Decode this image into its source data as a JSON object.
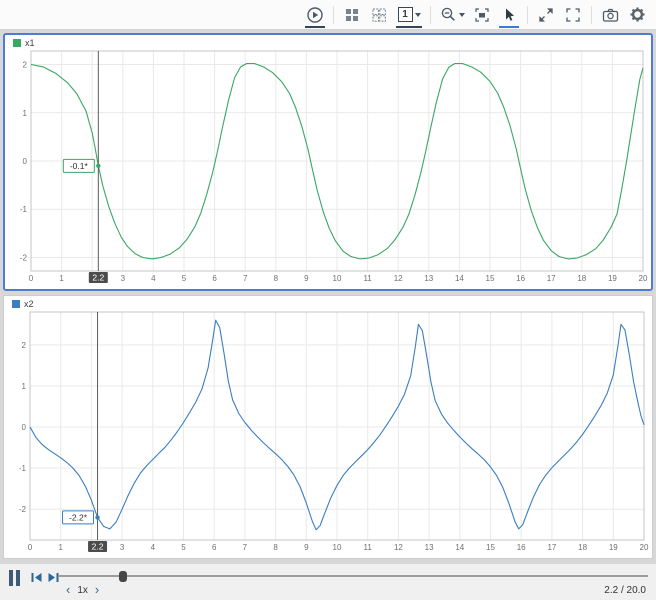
{
  "toolbar": {
    "display_count": "1",
    "icons": [
      "run-icon",
      "layout-grid-icon",
      "edit-layout-icon",
      "display-count-icon",
      "dropdown-caret-icon",
      "zoom-out-icon",
      "fit-to-view-icon",
      "pointer-icon",
      "expand-icon",
      "fullscreen-icon",
      "camera-icon",
      "gear-icon"
    ]
  },
  "chart_data": [
    {
      "id": "x1",
      "type": "line",
      "title": "x1",
      "color": "#3aa763",
      "xlim": [
        0,
        20
      ],
      "ylim": [
        -2.28,
        2.28
      ],
      "xticks": [
        0,
        1,
        2,
        3,
        4,
        5,
        6,
        7,
        8,
        9,
        10,
        11,
        12,
        13,
        14,
        15,
        16,
        17,
        18,
        19,
        20
      ],
      "yticks": [
        -2,
        -1,
        0,
        1,
        2
      ],
      "grid": true,
      "cursor": {
        "x": 2.2,
        "y": -0.1,
        "value_label": "-0.1*",
        "axis_label": "2.2"
      },
      "points": [
        [
          0,
          2.0
        ],
        [
          0.4,
          1.95
        ],
        [
          0.8,
          1.82
        ],
        [
          1.2,
          1.62
        ],
        [
          1.5,
          1.39
        ],
        [
          1.8,
          1.03
        ],
        [
          2.0,
          0.58
        ],
        [
          2.1,
          0.25
        ],
        [
          2.2,
          -0.1
        ],
        [
          2.35,
          -0.52
        ],
        [
          2.55,
          -0.96
        ],
        [
          2.75,
          -1.31
        ],
        [
          2.95,
          -1.58
        ],
        [
          3.15,
          -1.77
        ],
        [
          3.4,
          -1.92
        ],
        [
          3.65,
          -2.0
        ],
        [
          3.95,
          -2.03
        ],
        [
          4.25,
          -2.0
        ],
        [
          4.55,
          -1.93
        ],
        [
          4.85,
          -1.8
        ],
        [
          5.1,
          -1.62
        ],
        [
          5.35,
          -1.37
        ],
        [
          5.55,
          -1.08
        ],
        [
          5.75,
          -0.68
        ],
        [
          5.95,
          -0.2
        ],
        [
          6.1,
          0.22
        ],
        [
          6.25,
          0.68
        ],
        [
          6.45,
          1.25
        ],
        [
          6.65,
          1.72
        ],
        [
          6.85,
          1.95
        ],
        [
          7.05,
          2.02
        ],
        [
          7.3,
          2.02
        ],
        [
          7.6,
          1.95
        ],
        [
          7.9,
          1.83
        ],
        [
          8.2,
          1.64
        ],
        [
          8.45,
          1.4
        ],
        [
          8.65,
          1.1
        ],
        [
          8.85,
          0.72
        ],
        [
          9.05,
          0.25
        ],
        [
          9.2,
          -0.18
        ],
        [
          9.35,
          -0.6
        ],
        [
          9.55,
          -1.05
        ],
        [
          9.75,
          -1.4
        ],
        [
          9.95,
          -1.66
        ],
        [
          10.2,
          -1.87
        ],
        [
          10.45,
          -1.98
        ],
        [
          10.75,
          -2.03
        ],
        [
          11.05,
          -2.01
        ],
        [
          11.35,
          -1.94
        ],
        [
          11.65,
          -1.81
        ],
        [
          11.9,
          -1.63
        ],
        [
          12.15,
          -1.38
        ],
        [
          12.35,
          -1.1
        ],
        [
          12.55,
          -0.7
        ],
        [
          12.75,
          -0.22
        ],
        [
          12.9,
          0.2
        ],
        [
          13.05,
          0.65
        ],
        [
          13.25,
          1.22
        ],
        [
          13.45,
          1.7
        ],
        [
          13.65,
          1.94
        ],
        [
          13.85,
          2.02
        ],
        [
          14.1,
          2.02
        ],
        [
          14.4,
          1.95
        ],
        [
          14.7,
          1.84
        ],
        [
          15.0,
          1.65
        ],
        [
          15.25,
          1.41
        ],
        [
          15.45,
          1.11
        ],
        [
          15.65,
          0.74
        ],
        [
          15.85,
          0.27
        ],
        [
          16.0,
          -0.16
        ],
        [
          16.15,
          -0.58
        ],
        [
          16.35,
          -1.03
        ],
        [
          16.55,
          -1.38
        ],
        [
          16.75,
          -1.65
        ],
        [
          17.0,
          -1.86
        ],
        [
          17.25,
          -1.98
        ],
        [
          17.55,
          -2.03
        ],
        [
          17.85,
          -2.01
        ],
        [
          18.15,
          -1.94
        ],
        [
          18.45,
          -1.82
        ],
        [
          18.7,
          -1.64
        ],
        [
          18.95,
          -1.38
        ],
        [
          19.15,
          -1.1
        ],
        [
          19.3,
          -0.6
        ],
        [
          19.45,
          -0.05
        ],
        [
          19.6,
          0.55
        ],
        [
          19.75,
          1.15
        ],
        [
          19.9,
          1.7
        ],
        [
          20,
          1.93
        ]
      ]
    },
    {
      "id": "x2",
      "type": "line",
      "title": "x2",
      "color": "#3a7ebf",
      "xlim": [
        0,
        20
      ],
      "ylim": [
        -2.75,
        2.8
      ],
      "xticks": [
        0,
        1,
        2,
        3,
        4,
        5,
        6,
        7,
        8,
        9,
        10,
        11,
        12,
        13,
        14,
        15,
        16,
        17,
        18,
        19,
        20
      ],
      "yticks": [
        -2,
        -1,
        0,
        1,
        2
      ],
      "grid": true,
      "cursor": {
        "x": 2.2,
        "y": -2.2,
        "value_label": "-2.2*",
        "axis_label": "2.2"
      },
      "points": [
        [
          0,
          0
        ],
        [
          0.2,
          -0.26
        ],
        [
          0.4,
          -0.43
        ],
        [
          0.6,
          -0.55
        ],
        [
          0.8,
          -0.65
        ],
        [
          1.0,
          -0.75
        ],
        [
          1.2,
          -0.86
        ],
        [
          1.4,
          -1.0
        ],
        [
          1.6,
          -1.18
        ],
        [
          1.8,
          -1.44
        ],
        [
          2.0,
          -1.78
        ],
        [
          2.2,
          -2.2
        ],
        [
          2.4,
          -2.42
        ],
        [
          2.6,
          -2.48
        ],
        [
          2.8,
          -2.32
        ],
        [
          3.0,
          -2.0
        ],
        [
          3.2,
          -1.66
        ],
        [
          3.4,
          -1.36
        ],
        [
          3.6,
          -1.12
        ],
        [
          3.8,
          -0.94
        ],
        [
          4.0,
          -0.79
        ],
        [
          4.2,
          -0.64
        ],
        [
          4.4,
          -0.49
        ],
        [
          4.6,
          -0.31
        ],
        [
          4.8,
          -0.11
        ],
        [
          5.0,
          0.11
        ],
        [
          5.2,
          0.35
        ],
        [
          5.4,
          0.61
        ],
        [
          5.6,
          0.92
        ],
        [
          5.8,
          1.44
        ],
        [
          5.95,
          2.12
        ],
        [
          6.05,
          2.6
        ],
        [
          6.18,
          2.42
        ],
        [
          6.32,
          1.8
        ],
        [
          6.46,
          1.12
        ],
        [
          6.6,
          0.66
        ],
        [
          6.8,
          0.33
        ],
        [
          7.0,
          0.11
        ],
        [
          7.2,
          -0.07
        ],
        [
          7.4,
          -0.23
        ],
        [
          7.6,
          -0.38
        ],
        [
          7.8,
          -0.52
        ],
        [
          8.0,
          -0.65
        ],
        [
          8.2,
          -0.79
        ],
        [
          8.4,
          -0.96
        ],
        [
          8.6,
          -1.17
        ],
        [
          8.8,
          -1.46
        ],
        [
          9.0,
          -1.85
        ],
        [
          9.2,
          -2.3
        ],
        [
          9.32,
          -2.5
        ],
        [
          9.45,
          -2.4
        ],
        [
          9.6,
          -2.1
        ],
        [
          9.8,
          -1.72
        ],
        [
          10.0,
          -1.42
        ],
        [
          10.2,
          -1.18
        ],
        [
          10.4,
          -1.0
        ],
        [
          10.6,
          -0.85
        ],
        [
          10.8,
          -0.7
        ],
        [
          11.0,
          -0.55
        ],
        [
          11.2,
          -0.38
        ],
        [
          11.4,
          -0.19
        ],
        [
          11.6,
          0.03
        ],
        [
          11.8,
          0.26
        ],
        [
          12.0,
          0.51
        ],
        [
          12.2,
          0.8
        ],
        [
          12.4,
          1.25
        ],
        [
          12.55,
          1.95
        ],
        [
          12.65,
          2.5
        ],
        [
          12.78,
          2.35
        ],
        [
          12.92,
          1.75
        ],
        [
          13.06,
          1.1
        ],
        [
          13.2,
          0.64
        ],
        [
          13.4,
          0.32
        ],
        [
          13.6,
          0.1
        ],
        [
          13.8,
          -0.08
        ],
        [
          14.0,
          -0.24
        ],
        [
          14.2,
          -0.39
        ],
        [
          14.4,
          -0.53
        ],
        [
          14.6,
          -0.66
        ],
        [
          14.8,
          -0.8
        ],
        [
          15.0,
          -0.97
        ],
        [
          15.2,
          -1.18
        ],
        [
          15.4,
          -1.47
        ],
        [
          15.6,
          -1.86
        ],
        [
          15.8,
          -2.31
        ],
        [
          15.92,
          -2.48
        ],
        [
          16.05,
          -2.38
        ],
        [
          16.2,
          -2.08
        ],
        [
          16.4,
          -1.7
        ],
        [
          16.6,
          -1.4
        ],
        [
          16.8,
          -1.17
        ],
        [
          17.0,
          -0.99
        ],
        [
          17.2,
          -0.84
        ],
        [
          17.4,
          -0.69
        ],
        [
          17.6,
          -0.54
        ],
        [
          17.8,
          -0.37
        ],
        [
          18.0,
          -0.18
        ],
        [
          18.2,
          0.04
        ],
        [
          18.4,
          0.27
        ],
        [
          18.6,
          0.52
        ],
        [
          18.8,
          0.82
        ],
        [
          19.0,
          1.27
        ],
        [
          19.15,
          1.97
        ],
        [
          19.25,
          2.5
        ],
        [
          19.38,
          2.36
        ],
        [
          19.52,
          1.76
        ],
        [
          19.66,
          1.1
        ],
        [
          19.8,
          0.6
        ],
        [
          19.9,
          0.28
        ],
        [
          20,
          0.05
        ]
      ]
    }
  ],
  "playback": {
    "speed_label": "1x",
    "time_display": "2.2 / 20.0",
    "current_time": 2.2,
    "total_time": 20.0,
    "progress_fraction": 0.11
  }
}
